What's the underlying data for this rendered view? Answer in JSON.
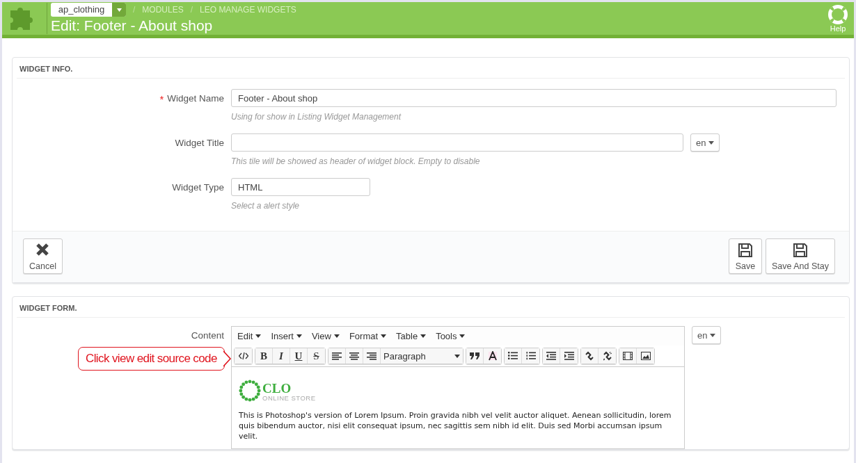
{
  "header": {
    "shop_select": "ap_clothing",
    "breadcrumb_separator": "/",
    "breadcrumbs": [
      "MODULES",
      "LEO MANAGE WIDGETS"
    ],
    "title": "Edit: Footer - About shop",
    "help": "Help"
  },
  "info_panel": {
    "heading": "WIDGET INFO.",
    "required_mark": "*",
    "fields": [
      {
        "kind": "text",
        "label": "Widget Name",
        "required": true,
        "value": "Footer - About shop",
        "hint": "Using for show in Listing Widget Management"
      },
      {
        "kind": "translatable",
        "label": "Widget Title",
        "required": false,
        "hint": "This tile will be showed as header of widget block. Empty to disable",
        "language": "en"
      },
      {
        "kind": "select",
        "label": "Widget Type",
        "required": false,
        "value": "HTML",
        "hint": "Select a alert style"
      }
    ],
    "left_buttons": [
      {
        "label": "Cancel",
        "kind": "cancel"
      }
    ],
    "right_buttons": [
      {
        "label": "Save",
        "kind": "save"
      },
      {
        "label": "Save And Stay",
        "kind": "save"
      }
    ]
  },
  "form_panel": {
    "heading": "WIDGET FORM.",
    "content_label": "Content",
    "language": "en",
    "menus": [
      "Edit",
      "Insert",
      "View",
      "Format",
      "Table",
      "Tools"
    ],
    "toolbar": [
      [
        {
          "kind": "source"
        }
      ],
      [
        {
          "kind": "bold",
          "label": "B"
        },
        {
          "kind": "italic",
          "label": "I"
        },
        {
          "kind": "underline",
          "label": "U"
        },
        {
          "kind": "strike",
          "label": "S"
        }
      ],
      [
        {
          "kind": "align-left"
        },
        {
          "kind": "align-center"
        },
        {
          "kind": "align-right"
        },
        {
          "kind": "select",
          "label": "Paragraph"
        }
      ],
      [
        {
          "kind": "quote"
        },
        {
          "kind": "font-color"
        }
      ],
      [
        {
          "kind": "bullets"
        },
        {
          "kind": "numbers"
        }
      ],
      [
        {
          "kind": "outdent"
        },
        {
          "kind": "indent"
        }
      ],
      [
        {
          "kind": "link"
        },
        {
          "kind": "unlink"
        }
      ],
      [
        {
          "kind": "media"
        },
        {
          "kind": "image"
        }
      ]
    ],
    "logo": {
      "name": "CLO",
      "tagline": "ONLINE STORE"
    },
    "body": "This is Photoshop's version of Lorem Ipsum. Proin gravida nibh vel velit auctor aliquet. Aenean sollicitudin, lorem quis bibendum auctor, nisi elit consequat ipsum, nec sagittis sem nibh id elit. Duis sed Morbi accumsan ipsum velit."
  },
  "callout": "Click view edit source code"
}
